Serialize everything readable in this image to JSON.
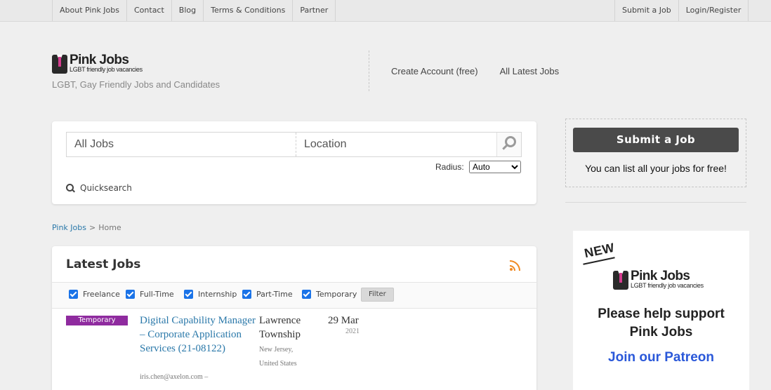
{
  "topnav": {
    "left": [
      "About Pink Jobs",
      "Contact",
      "Blog",
      "Terms & Conditions",
      "Partner"
    ],
    "right": [
      "Submit a Job",
      "Login/Register"
    ]
  },
  "header": {
    "logo_title": "Pink Jobs",
    "logo_subtitle": "LGBT friendly job vacancies",
    "tagline": "LGBT, Gay Friendly Jobs and Candidates",
    "links": [
      "Create Account (free)",
      "All Latest Jobs"
    ]
  },
  "search": {
    "jobs_placeholder": "All Jobs",
    "location_placeholder": "Location",
    "radius_label": "Radius:",
    "radius_value": "Auto",
    "quicksearch_label": "Quicksearch"
  },
  "breadcrumb": {
    "root": "Pink Jobs",
    "sep": ">",
    "current": "Home"
  },
  "latest_jobs": {
    "title": "Latest Jobs",
    "filters": [
      "Freelance",
      "Full-Time",
      "Internship",
      "Part-Time",
      "Temporary"
    ],
    "filter_button": "Filter",
    "job": {
      "type": "Temporary",
      "title": "Digital Capability Manager – Corporate Application Services (21-08122)",
      "email": "iris.chen@axelon.com –",
      "location": "Lawrence Township",
      "region": "New Jersey,",
      "country": "United States",
      "date": "29 Mar",
      "year": "2021"
    }
  },
  "sidebar": {
    "submit_button": "Submit a Job",
    "submit_note": "You can list all your jobs for free!",
    "new_label": "NEW",
    "support_line1": "Please help support",
    "support_line2": "Pink Jobs",
    "join_link": "Join our Patreon"
  },
  "colors": {
    "accent_link": "#2a78a9",
    "badge_temporary": "#8f2b9f",
    "patreon_link": "#2a58d9",
    "rss": "#f08a24"
  }
}
